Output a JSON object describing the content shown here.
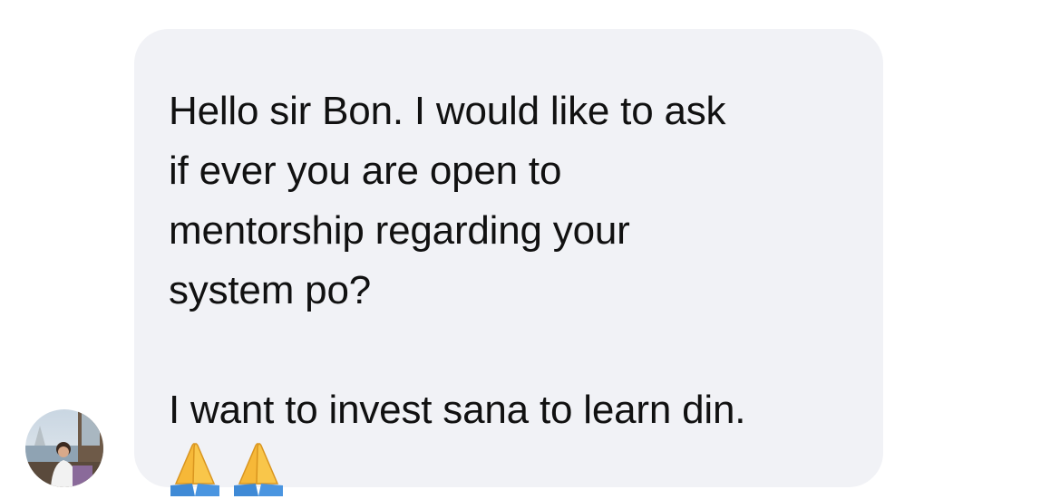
{
  "message": {
    "lines": [
      "Hello sir Bon. I would like to ask",
      "if ever you are open to",
      "mentorship regarding your",
      "system po?",
      "I want to invest sana to learn din."
    ],
    "emojis": [
      "folded-hands-icon",
      "folded-hands-icon"
    ]
  },
  "sender": {
    "avatar_icon": "profile-photo"
  },
  "colors": {
    "bubble": "#f1f2f6",
    "text": "#111111",
    "emoji_hands": "#f6b838",
    "emoji_sleeve": "#3f8ad6"
  }
}
